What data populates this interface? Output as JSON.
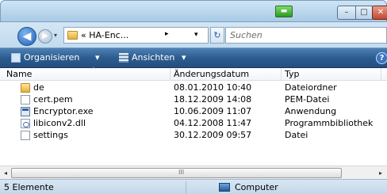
{
  "titlebar": {
    "minimize_glyph": "–",
    "maximize_glyph": "□",
    "close_glyph": "✕"
  },
  "navigation": {
    "back_glyph": "◀",
    "forward_glyph": "▶",
    "dropdown_glyph": "▾",
    "breadcrumb": "« HA-Enc...",
    "breadcrumb_arrow": "▸",
    "address_dropdown": "▾",
    "refresh_glyph": "↻",
    "search_placeholder": "Suchen"
  },
  "toolbar": {
    "organize_label": "Organisieren",
    "views_label": "Ansichten",
    "dropdown_glyph": "▾",
    "help_glyph": "?"
  },
  "columns": {
    "name": "Name",
    "date": "Änderungsdatum",
    "type": "Typ"
  },
  "files": [
    {
      "name": "de",
      "date": "08.01.2010 10:40",
      "type": "Dateiordner",
      "icon": "folder-icon"
    },
    {
      "name": "cert.pem",
      "date": "18.12.2009 14:08",
      "type": "PEM-Datei",
      "icon": "file-icon"
    },
    {
      "name": "Encryptor.exe",
      "date": "10.06.2009 11:07",
      "type": "Anwendung",
      "icon": "application-icon"
    },
    {
      "name": "libiconv2.dll",
      "date": "04.12.2008 11:47",
      "type": "Programmbibliothek",
      "icon": "dll-icon"
    },
    {
      "name": "settings",
      "date": "30.12.2009 09:57",
      "type": "Datei",
      "icon": "file-icon"
    }
  ],
  "scrollbar": {
    "left_glyph": "◂",
    "grip_glyph": "III",
    "right_glyph": "▸"
  },
  "statusbar": {
    "count": "5 Elemente",
    "location": "Computer"
  }
}
